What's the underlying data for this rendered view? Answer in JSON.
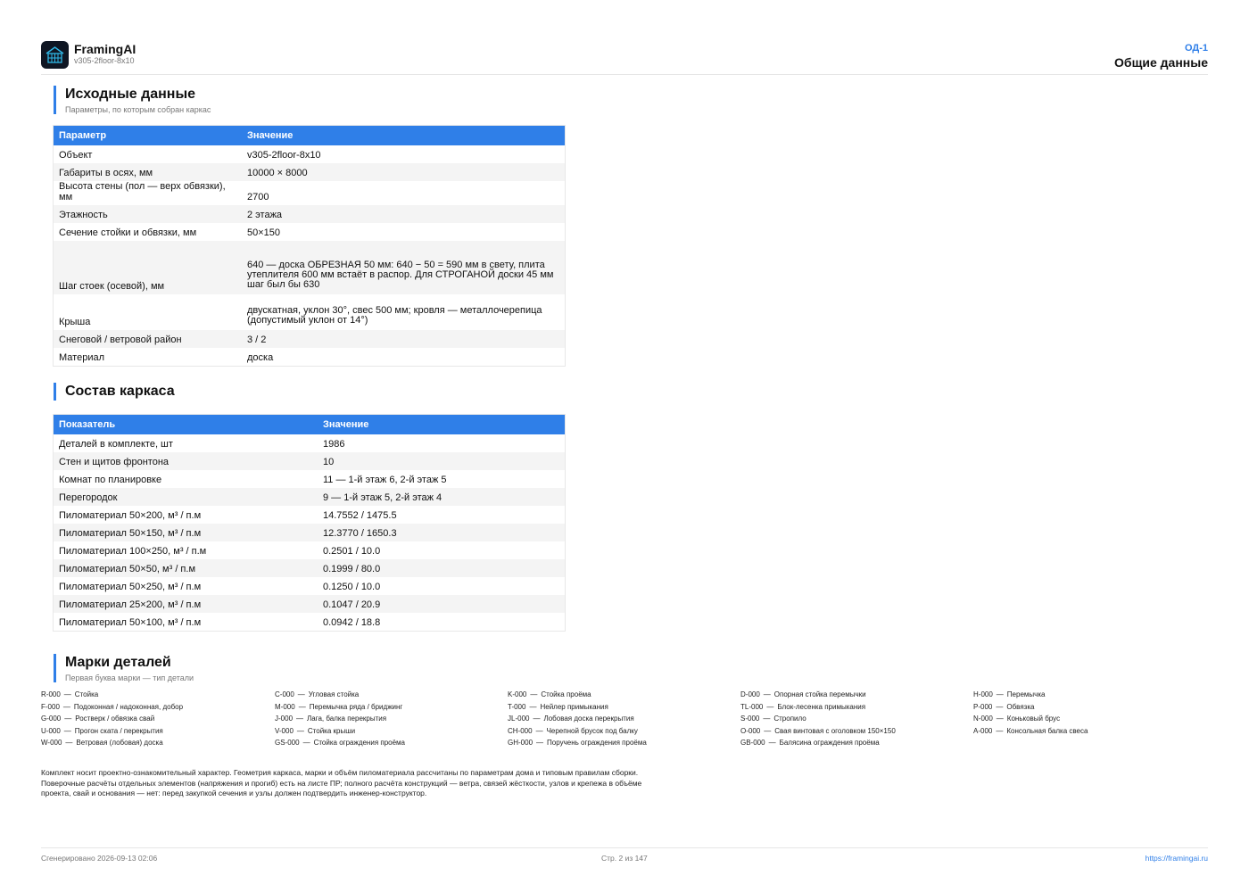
{
  "header": {
    "app_name": "FramingAI",
    "app_version": "v305-2floor-8x10",
    "sheet_code": "ОД-1",
    "sheet_title": "Общие данные",
    "logo_icon": "house-frame-icon",
    "logo_bg": "#0f1623",
    "logo_accent": "#2fb8e8"
  },
  "colors": {
    "accent": "#2f7fe8",
    "table_header": "#2f7fe8",
    "row_alt": "#f4f4f4"
  },
  "source": {
    "title": "Исходные данные",
    "subtitle": "Параметры, по которым собран каркас",
    "columns": [
      "Параметр",
      "Значение"
    ],
    "rows": [
      [
        "Объект",
        "v305-2floor-8x10"
      ],
      [
        "Габариты в осях, мм",
        "10000 × 8000"
      ],
      [
        "Высота стены (пол — верх обвязки), мм",
        "2700"
      ],
      [
        "Этажность",
        "2 этажа"
      ],
      [
        "Сечение стойки и обвязки, мм",
        "50×150"
      ],
      [
        "Шаг стоек (осевой), мм",
        "640 — доска ОБРЕЗНАЯ 50 мм: 640 − 50 = 590 мм в свету, плита утеплителя 600 мм встаёт в распор. Для СТРОГАНОЙ доски 45 мм шаг был бы 630"
      ],
      [
        "Крыша",
        "двускатная, уклон 30°, свес 500 мм; кровля — металлочерепица (допустимый уклон от 14°)"
      ],
      [
        "Снеговой / ветровой район",
        "3 / 2"
      ],
      [
        "Материал",
        "доска"
      ]
    ]
  },
  "composition": {
    "title": "Состав каркаса",
    "columns": [
      "Показатель",
      "Значение"
    ],
    "rows": [
      [
        "Деталей в комплекте, шт",
        "1986"
      ],
      [
        "Стен и щитов фронтона",
        "10"
      ],
      [
        "Комнат по планировке",
        "11 — 1-й этаж 6, 2-й этаж 5"
      ],
      [
        "Перегородок",
        "9 — 1-й этаж 5, 2-й этаж 4"
      ],
      [
        "Пиломатериал 50×200, м³ / п.м",
        "14.7552 / 1475.5"
      ],
      [
        "Пиломатериал 50×150, м³ / п.м",
        "12.3770 / 1650.3"
      ],
      [
        "Пиломатериал 100×250, м³ / п.м",
        "0.2501 / 10.0"
      ],
      [
        "Пиломатериал 50×50, м³ / п.м",
        "0.1999 / 80.0"
      ],
      [
        "Пиломатериал 50×250, м³ / п.м",
        "0.1250 / 10.0"
      ],
      [
        "Пиломатериал 25×200, м³ / п.м",
        "0.1047 / 20.9"
      ],
      [
        "Пиломатериал 50×100, м³ / п.м",
        "0.0942 / 18.8"
      ]
    ]
  },
  "marks": {
    "title": "Марки деталей",
    "subtitle": "Первая буква марки — тип детали",
    "dash": "—",
    "columns": [
      [
        [
          "R-000",
          "Стойка"
        ],
        [
          "F-000",
          "Подоконная / надоконная, добор"
        ],
        [
          "G-000",
          "Ростверк / обвязка свай"
        ],
        [
          "U-000",
          "Прогон ската / перекрытия"
        ],
        [
          "W-000",
          "Ветровая (лобовая) доска"
        ]
      ],
      [
        [
          "C-000",
          "Угловая стойка"
        ],
        [
          "M-000",
          "Перемычка ряда / бриджинг"
        ],
        [
          "J-000",
          "Лага, балка перекрытия"
        ],
        [
          "V-000",
          "Стойка крыши"
        ],
        [
          "GS-000",
          "Стойка ограждения проёма"
        ]
      ],
      [
        [
          "K-000",
          "Стойка проёма"
        ],
        [
          "T-000",
          "Нейлер примыкания"
        ],
        [
          "JL-000",
          "Лобовая доска перекрытия"
        ],
        [
          "CH-000",
          "Черепной брусок под балку"
        ],
        [
          "GH-000",
          "Поручень ограждения проёма"
        ]
      ],
      [
        [
          "D-000",
          "Опорная стойка перемычки"
        ],
        [
          "TL-000",
          "Блок-лесенка примыкания"
        ],
        [
          "S-000",
          "Стропило"
        ],
        [
          "O-000",
          "Свая винтовая с оголовком 150×150"
        ],
        [
          "GB-000",
          "Балясина ограждения проёма"
        ]
      ],
      [
        [
          "H-000",
          "Перемычка"
        ],
        [
          "P-000",
          "Обвязка"
        ],
        [
          "N-000",
          "Коньковый брус"
        ],
        [
          "A-000",
          "Консольная балка свеса"
        ]
      ]
    ]
  },
  "note": {
    "lines": [
      "Комплект носит проектно-ознакомительный характер. Геометрия каркаса, марки и объём пиломатериала рассчитаны по параметрам дома и типовым правилам сборки.",
      "Поверочные расчёты отдельных элементов (напряжения и прогиб) есть на листе ПР; полного расчёта конструкций — ветра, связей жёсткости, узлов и крепежа в объёме",
      "проекта, свай и основания — нет: перед закупкой сечения и узлы должен подтвердить инженер-конструктор."
    ]
  },
  "footer": {
    "generated": "Сгенерировано 2026-09-13 02:06",
    "page": "Стр. 2 из 147",
    "url": "https://framingai.ru"
  }
}
